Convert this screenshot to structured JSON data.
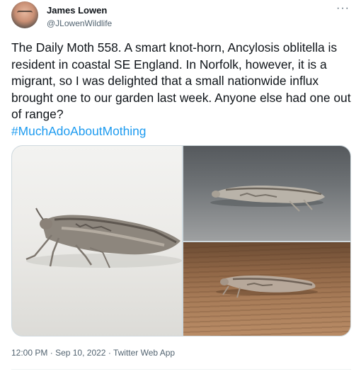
{
  "author": {
    "display_name": "James Lowen",
    "handle": "@JLowenWildlife",
    "avatar_icon": "profile-photo"
  },
  "more_icon": "more-options-icon",
  "tweet": {
    "text": "The Daily Moth 558. A smart knot-horn, Ancylosis oblitella is resident in coastal SE England. In Norfolk, however, it is a migrant, so I was delighted that a small nationwide influx brought one to our garden last week. Anyone else had one out of range?",
    "hashtag": "#MuchAdoAboutMothing"
  },
  "media": {
    "count": 3,
    "subjects": [
      "moth-on-white",
      "moth-on-grey",
      "moth-on-wood"
    ]
  },
  "meta": {
    "time": "12:00 PM",
    "separator": "·",
    "date": "Sep 10, 2022",
    "source": "Twitter Web App"
  },
  "colors": {
    "text": "#0f1419",
    "secondary": "#536471",
    "link": "#1d9bf0",
    "border": "#cfd9de"
  }
}
